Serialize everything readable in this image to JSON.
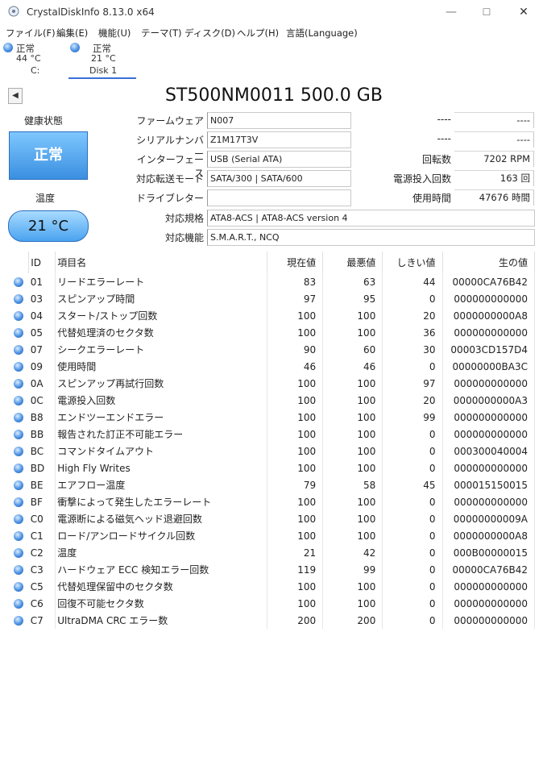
{
  "window": {
    "title": "CrystalDiskInfo 8.13.0 x64",
    "minimize": "—",
    "maximize": "☐",
    "close": "✕"
  },
  "menu": [
    "ファイル(F)",
    "編集(E)",
    "機能(U)",
    "テーマ(T)",
    "ディスク(D)",
    "ヘルプ(H)",
    "言語(Language)"
  ],
  "disks": [
    {
      "status": "正常",
      "temp": "44 °C",
      "name": "C:"
    },
    {
      "status": "正常",
      "temp": "21 °C",
      "name": "Disk 1"
    }
  ],
  "model": "ST500NM0011 500.0 GB",
  "health": {
    "label": "健康状態",
    "status": "正常",
    "color": "#3a8fe0"
  },
  "temperature": {
    "label": "温度",
    "value": "21 °C"
  },
  "info": {
    "firmware_label": "ファームウェア",
    "firmware": "N007",
    "serial_label": "シリアルナンバー",
    "serial": "Z1M17T3V",
    "interface_label": "インターフェース",
    "interface": "USB (Serial ATA)",
    "transfer_label": "対応転送モード",
    "transfer": "SATA/300 | SATA/600",
    "drive_letter_label": "ドライブレター",
    "drive_letter": "",
    "standard_label": "対応規格",
    "standard": "ATA8-ACS | ATA8-ACS version 4",
    "features_label": "対応機能",
    "features": "S.M.A.R.T., NCQ",
    "right1_label": "----",
    "right1": "----",
    "right2_label": "----",
    "right2": "----",
    "rotation_label": "回転数",
    "rotation": "7202 RPM",
    "power_count_label": "電源投入回数",
    "power_count": "163 回",
    "hours_label": "使用時間",
    "hours": "47676 時間"
  },
  "smart_headers": {
    "id": "ID",
    "name": "項目名",
    "current": "現在値",
    "worst": "最悪値",
    "threshold": "しきい値",
    "raw": "生の値"
  },
  "smart_rows": [
    {
      "id": "01",
      "name": "リードエラーレート",
      "current": "83",
      "worst": "63",
      "threshold": "44",
      "raw": "00000CA76B42"
    },
    {
      "id": "03",
      "name": "スピンアップ時間",
      "current": "97",
      "worst": "95",
      "threshold": "0",
      "raw": "000000000000"
    },
    {
      "id": "04",
      "name": "スタート/ストップ回数",
      "current": "100",
      "worst": "100",
      "threshold": "20",
      "raw": "0000000000A8"
    },
    {
      "id": "05",
      "name": "代替処理済のセクタ数",
      "current": "100",
      "worst": "100",
      "threshold": "36",
      "raw": "000000000000"
    },
    {
      "id": "07",
      "name": "シークエラーレート",
      "current": "90",
      "worst": "60",
      "threshold": "30",
      "raw": "00003CD157D4"
    },
    {
      "id": "09",
      "name": "使用時間",
      "current": "46",
      "worst": "46",
      "threshold": "0",
      "raw": "00000000BA3C"
    },
    {
      "id": "0A",
      "name": "スピンアップ再試行回数",
      "current": "100",
      "worst": "100",
      "threshold": "97",
      "raw": "000000000000"
    },
    {
      "id": "0C",
      "name": "電源投入回数",
      "current": "100",
      "worst": "100",
      "threshold": "20",
      "raw": "0000000000A3"
    },
    {
      "id": "B8",
      "name": "エンドツーエンドエラー",
      "current": "100",
      "worst": "100",
      "threshold": "99",
      "raw": "000000000000"
    },
    {
      "id": "BB",
      "name": "報告された訂正不可能エラー",
      "current": "100",
      "worst": "100",
      "threshold": "0",
      "raw": "000000000000"
    },
    {
      "id": "BC",
      "name": "コマンドタイムアウト",
      "current": "100",
      "worst": "100",
      "threshold": "0",
      "raw": "000300040004"
    },
    {
      "id": "BD",
      "name": "High Fly Writes",
      "current": "100",
      "worst": "100",
      "threshold": "0",
      "raw": "000000000000"
    },
    {
      "id": "BE",
      "name": "エアフロー温度",
      "current": "79",
      "worst": "58",
      "threshold": "45",
      "raw": "000015150015"
    },
    {
      "id": "BF",
      "name": "衝撃によって発生したエラーレート",
      "current": "100",
      "worst": "100",
      "threshold": "0",
      "raw": "000000000000"
    },
    {
      "id": "C0",
      "name": "電源断による磁気ヘッド退避回数",
      "current": "100",
      "worst": "100",
      "threshold": "0",
      "raw": "00000000009A"
    },
    {
      "id": "C1",
      "name": "ロード/アンロードサイクル回数",
      "current": "100",
      "worst": "100",
      "threshold": "0",
      "raw": "0000000000A8"
    },
    {
      "id": "C2",
      "name": "温度",
      "current": "21",
      "worst": "42",
      "threshold": "0",
      "raw": "000B00000015"
    },
    {
      "id": "C3",
      "name": "ハードウェア ECC 検知エラー回数",
      "current": "119",
      "worst": "99",
      "threshold": "0",
      "raw": "00000CA76B42"
    },
    {
      "id": "C5",
      "name": "代替処理保留中のセクタ数",
      "current": "100",
      "worst": "100",
      "threshold": "0",
      "raw": "000000000000"
    },
    {
      "id": "C6",
      "name": "回復不可能セクタ数",
      "current": "100",
      "worst": "100",
      "threshold": "0",
      "raw": "000000000000"
    },
    {
      "id": "C7",
      "name": "UltraDMA CRC エラー数",
      "current": "200",
      "worst": "200",
      "threshold": "0",
      "raw": "000000000000"
    }
  ]
}
